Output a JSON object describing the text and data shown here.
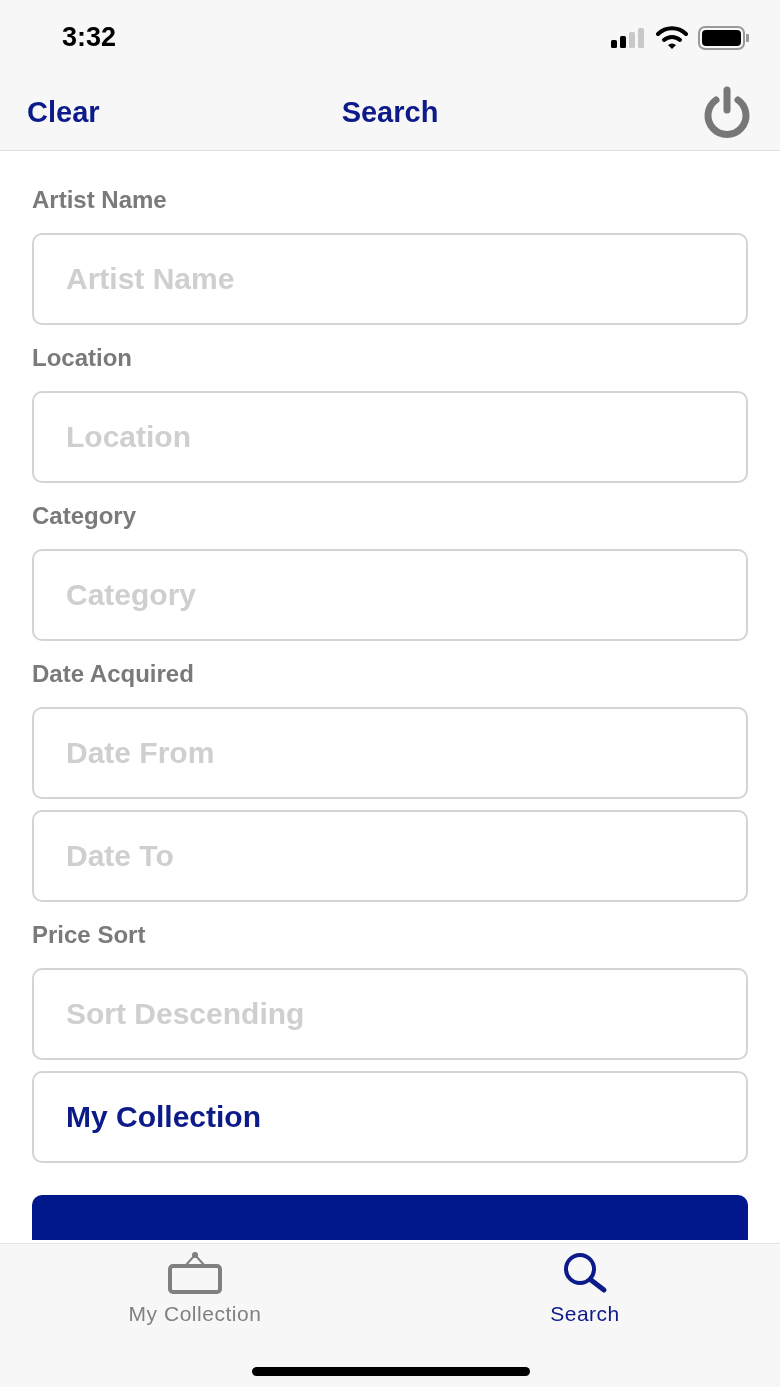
{
  "status_bar": {
    "time": "3:32"
  },
  "nav_bar": {
    "left_button": "Clear",
    "title": "Search"
  },
  "form": [
    {
      "kind": "label",
      "text": "Artist Name"
    },
    {
      "kind": "field",
      "placeholder": "Artist Name"
    },
    {
      "kind": "label",
      "text": "Location"
    },
    {
      "kind": "field",
      "placeholder": "Location"
    },
    {
      "kind": "label",
      "text": "Category"
    },
    {
      "kind": "field",
      "placeholder": "Category"
    },
    {
      "kind": "label",
      "text": "Date Acquired"
    },
    {
      "kind": "field",
      "placeholder": "Date From"
    },
    {
      "kind": "field",
      "placeholder": "Date To"
    },
    {
      "kind": "label",
      "text": "Price Sort"
    },
    {
      "kind": "field",
      "placeholder": "Sort Descending"
    },
    {
      "kind": "field",
      "value": "My Collection"
    }
  ],
  "tabs": [
    {
      "label": "My Collection",
      "selected": false
    },
    {
      "label": "Search",
      "selected": true
    }
  ]
}
